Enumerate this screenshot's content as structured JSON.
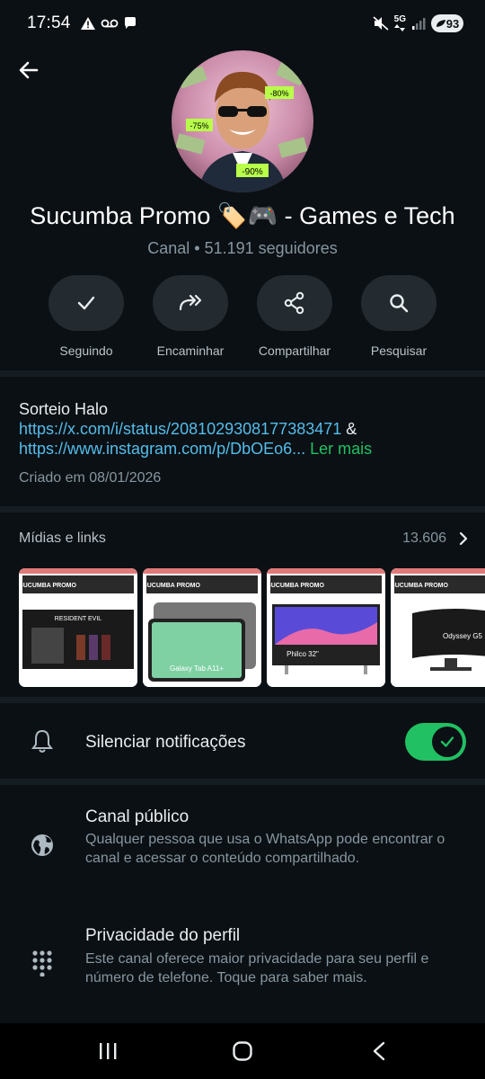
{
  "status_bar": {
    "time": "17:54",
    "network": "5G",
    "battery": "93"
  },
  "channel": {
    "name": "Sucumba Promo 🏷️🎮  - Games e Tech",
    "type": "Canal",
    "followers": "51.191 seguidores",
    "avatar_tags": [
      "-80%",
      "-75%",
      "-90%"
    ]
  },
  "actions": [
    {
      "label": "Seguindo",
      "icon": "check-icon"
    },
    {
      "label": "Encaminhar",
      "icon": "forward-icon"
    },
    {
      "label": "Compartilhar",
      "icon": "share-icon"
    },
    {
      "label": "Pesquisar",
      "icon": "search-icon"
    }
  ],
  "description": {
    "title": "Sorteio Halo",
    "link1": "https://x.com/i/status/2081029308177383471",
    "amp": " &",
    "link2": "https://www.instagram.com/p/DbOEo6...",
    "read_more": "Ler mais",
    "created": "Criado em 08/01/2026"
  },
  "media": {
    "title": "Mídias e links",
    "count": "13.606",
    "thumbs": [
      {
        "brand": "SUCUMBA PROMO",
        "product": "RESIDENT EVIL"
      },
      {
        "brand": "SUCUMBA PROMO",
        "product": "Galaxy Tab A11+"
      },
      {
        "brand": "SUCUMBA PROMO",
        "product": "Philco 32\""
      },
      {
        "brand": "SUCUMBA PROMO",
        "product": "Odyssey G5"
      }
    ]
  },
  "settings": {
    "mute": {
      "title": "Silenciar notificações",
      "enabled": true
    },
    "public": {
      "title": "Canal público",
      "desc": "Qualquer pessoa que usa o WhatsApp pode encontrar o canal e acessar o conteúdo compartilhado."
    },
    "privacy": {
      "title": "Privacidade do perfil",
      "desc": "Este canal oferece maior privacidade para seu perfil e número de telefone. Toque para saber mais."
    }
  },
  "colors": {
    "background": "#0b1014",
    "accent_green": "#21c063",
    "link_blue": "#53bdeb",
    "secondary_text": "#8696a0"
  }
}
